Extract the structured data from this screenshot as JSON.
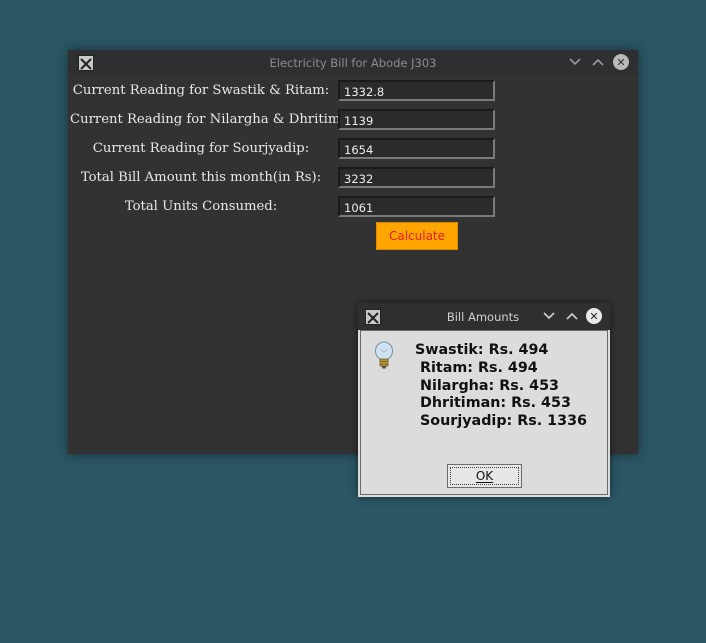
{
  "main_window": {
    "title": "Electricity Bill for Abode J303",
    "fields": [
      {
        "label": "Current Reading for Swastik & Ritam:",
        "value": "1332.8"
      },
      {
        "label": "Current Reading for Nilargha & Dhritiman:",
        "value": "1139"
      },
      {
        "label": "Current Reading for Sourjyadip:",
        "value": "1654"
      },
      {
        "label": "Total Bill Amount this month(in Rs):",
        "value": "3232"
      },
      {
        "label": "Total Units Consumed:",
        "value": "1061"
      }
    ],
    "calculate_label": "Calculate"
  },
  "dialog": {
    "title": "Bill Amounts",
    "lines": [
      "Swastik: Rs. 494",
      " Ritam: Rs. 494",
      " Nilargha: Rs. 453",
      " Dhritiman: Rs. 453",
      " Sourjyadip: Rs. 1336"
    ],
    "ok_label": "OK",
    "icon": "lightbulb-icon"
  },
  "icons": {
    "app": "x-app-icon",
    "minimize": "chevron-down-icon",
    "maximize": "chevron-up-icon",
    "close": "close-icon"
  },
  "colors": {
    "desktop": "#2b5664",
    "window_bg": "#323232",
    "calculate_bg": "#ffa500",
    "calculate_text": "#e02020"
  }
}
